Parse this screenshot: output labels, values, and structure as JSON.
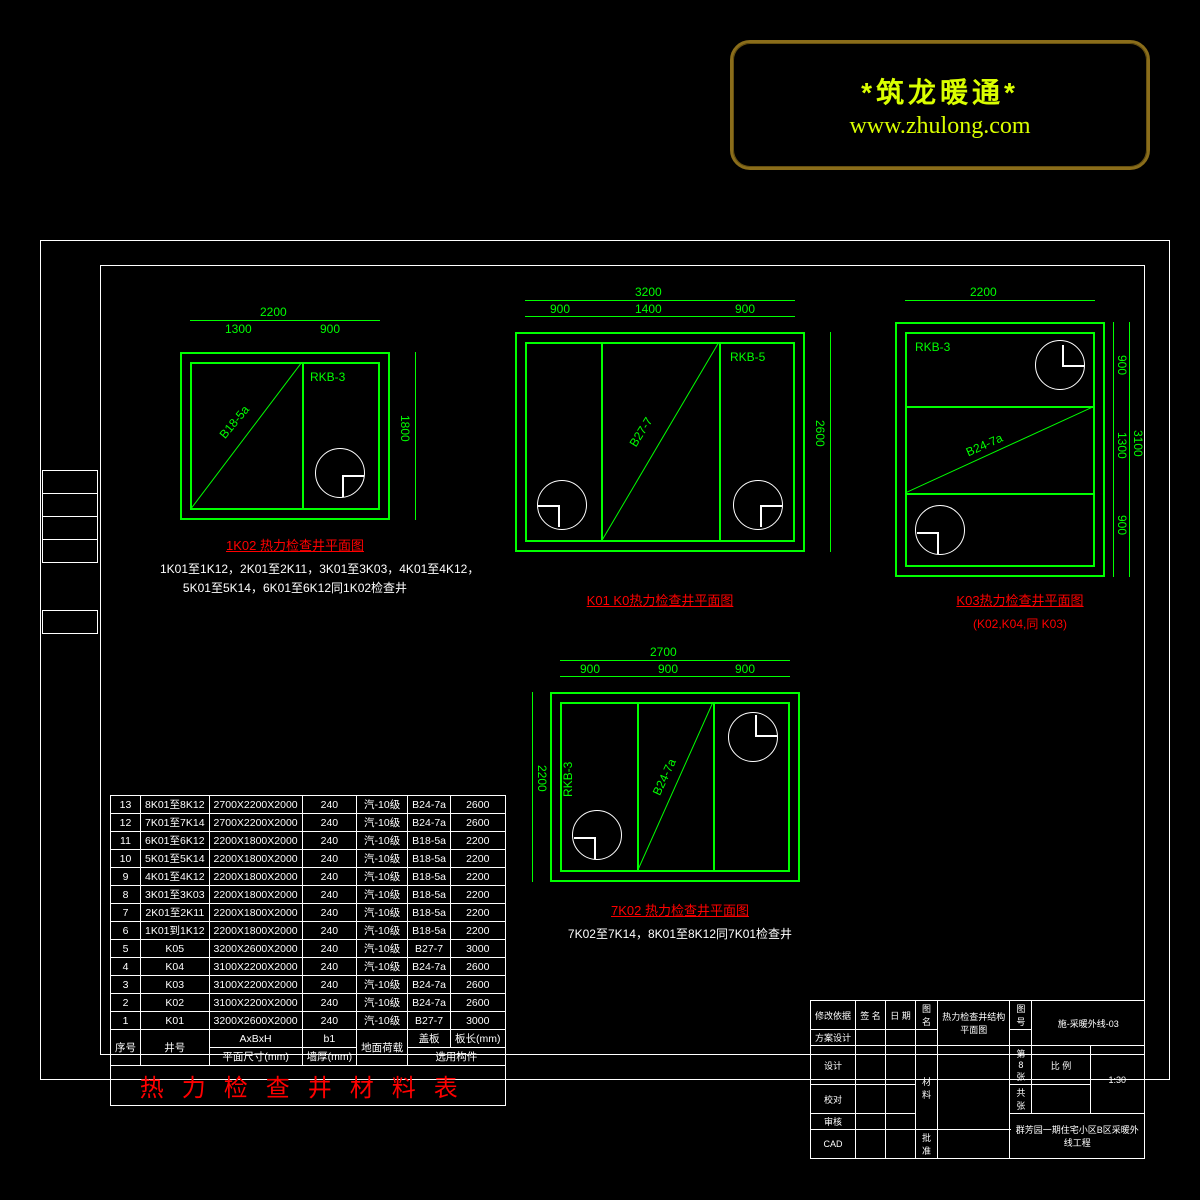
{
  "watermark": {
    "t1": "*筑龙暖通*",
    "t2": "www.zhulong.com"
  },
  "plans": {
    "p1": {
      "total_w": "2200",
      "w1": "1300",
      "w2": "900",
      "h": "1800",
      "label": "RKB-3",
      "diag": "B18-5a",
      "title": "1K02 热力检查井平面图",
      "sub1": "1K01至1K12，2K01至2K11，3K01至3K03，4K01至4K12，",
      "sub2": "5K01至5K14，6K01至6K12同1K02检查井"
    },
    "p2": {
      "total_w": "3200",
      "w1": "900",
      "w2": "1400",
      "w3": "900",
      "h": "2600",
      "label": "RKB-5",
      "diag": "B27-7",
      "title": "K01 K0热力检查井平面图"
    },
    "p3": {
      "total_w": "2200",
      "h_total": "3100",
      "h1": "900",
      "h2": "1300",
      "h3": "900",
      "label": "RKB-3",
      "diag": "B24-7a",
      "title": "K03热力检查井平面图",
      "sub": "(K02,K04,同 K03)"
    },
    "p4": {
      "total_w": "2700",
      "w1": "900",
      "w2": "900",
      "w3": "900",
      "h": "2200",
      "label": "RKB-3",
      "diag": "B24-7a",
      "title": "7K02 热力检查井平面图",
      "sub": "7K02至7K14，8K01至8K12同7K01检查井"
    }
  },
  "table": {
    "headers": {
      "c1": "序号",
      "c2": "井号",
      "c3": "AxBxH",
      "c3b": "平面尺寸(mm)",
      "c4": "b1",
      "c4b": "墙厚(mm)",
      "c5": "地面荷载",
      "c6": "盖板",
      "c6b": "选用构件",
      "c7": "板长(mm)"
    },
    "title": "热力检查井材料表",
    "rows": [
      {
        "n": "13",
        "id": "8K01至8K12",
        "size": "2700X2200X2000",
        "b": "240",
        "load": "汽-10级",
        "cover": "B24-7a",
        "len": "2600"
      },
      {
        "n": "12",
        "id": "7K01至7K14",
        "size": "2700X2200X2000",
        "b": "240",
        "load": "汽-10级",
        "cover": "B24-7a",
        "len": "2600"
      },
      {
        "n": "11",
        "id": "6K01至6K12",
        "size": "2200X1800X2000",
        "b": "240",
        "load": "汽-10级",
        "cover": "B18-5a",
        "len": "2200"
      },
      {
        "n": "10",
        "id": "5K01至5K14",
        "size": "2200X1800X2000",
        "b": "240",
        "load": "汽-10级",
        "cover": "B18-5a",
        "len": "2200"
      },
      {
        "n": "9",
        "id": "4K01至4K12",
        "size": "2200X1800X2000",
        "b": "240",
        "load": "汽-10级",
        "cover": "B18-5a",
        "len": "2200"
      },
      {
        "n": "8",
        "id": "3K01至3K03",
        "size": "2200X1800X2000",
        "b": "240",
        "load": "汽-10级",
        "cover": "B18-5a",
        "len": "2200"
      },
      {
        "n": "7",
        "id": "2K01至2K11",
        "size": "2200X1800X2000",
        "b": "240",
        "load": "汽-10级",
        "cover": "B18-5a",
        "len": "2200"
      },
      {
        "n": "6",
        "id": "1K01到1K12",
        "size": "2200X1800X2000",
        "b": "240",
        "load": "汽-10级",
        "cover": "B18-5a",
        "len": "2200"
      },
      {
        "n": "5",
        "id": "K05",
        "size": "3200X2600X2000",
        "b": "240",
        "load": "汽-10级",
        "cover": "B27-7",
        "len": "3000"
      },
      {
        "n": "4",
        "id": "K04",
        "size": "3100X2200X2000",
        "b": "240",
        "load": "汽-10级",
        "cover": "B24-7a",
        "len": "2600"
      },
      {
        "n": "3",
        "id": "K03",
        "size": "3100X2200X2000",
        "b": "240",
        "load": "汽-10级",
        "cover": "B24-7a",
        "len": "2600"
      },
      {
        "n": "2",
        "id": "K02",
        "size": "3100X2200X2000",
        "b": "240",
        "load": "汽-10级",
        "cover": "B24-7a",
        "len": "2600"
      },
      {
        "n": "1",
        "id": "K01",
        "size": "3200X2600X2000",
        "b": "240",
        "load": "汽-10级",
        "cover": "B27-7",
        "len": "3000"
      }
    ]
  },
  "titleblock": {
    "l1": "修改依据",
    "l2": "签 名",
    "l3": "日 期",
    "l4": "图名",
    "l5": "图号",
    "name": "热力检查井结构平面图",
    "num": "施-采暖外线-03",
    "r1": "方案设计",
    "r2": "设计",
    "r3": "校对",
    "r4": "审核",
    "r5": "CAD",
    "r6": "批准",
    "material": "材料",
    "page": "第 8 张",
    "pages": "共 张",
    "scale": "比 例",
    "scale_v": "1:30",
    "proj": "群芳园一期住宅小区B区采暖外线工程"
  }
}
